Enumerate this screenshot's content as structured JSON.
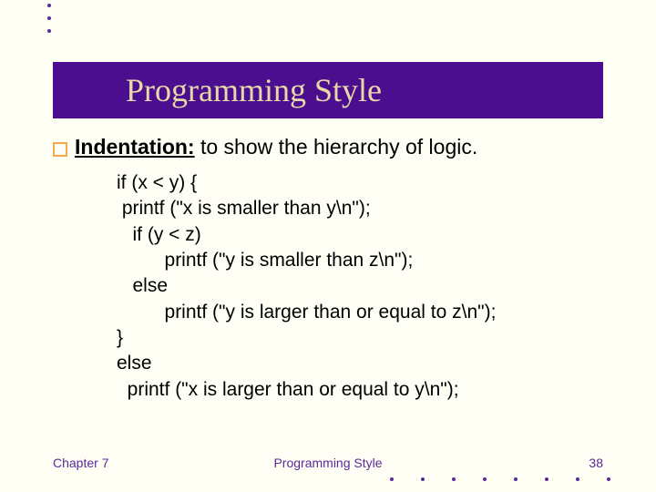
{
  "title": "Programming Style",
  "bullet": {
    "heading": "Indentation:",
    "rest": " to show the hierarchy of logic."
  },
  "code": {
    "l1": "if (x < y) {",
    "l2": " printf (\"x is smaller than y\\n\");",
    "l3": "   if (y < z)",
    "l4": "         printf (\"y is smaller than z\\n\");",
    "l5": "   else",
    "l6": "         printf (\"y is larger than or equal to z\\n\");",
    "l7": "}",
    "l8": "else",
    "l9": "  printf (\"x is larger than or equal to y\\n\");"
  },
  "footer": {
    "left": "Chapter 7",
    "center": "Programming Style",
    "right": "38"
  }
}
